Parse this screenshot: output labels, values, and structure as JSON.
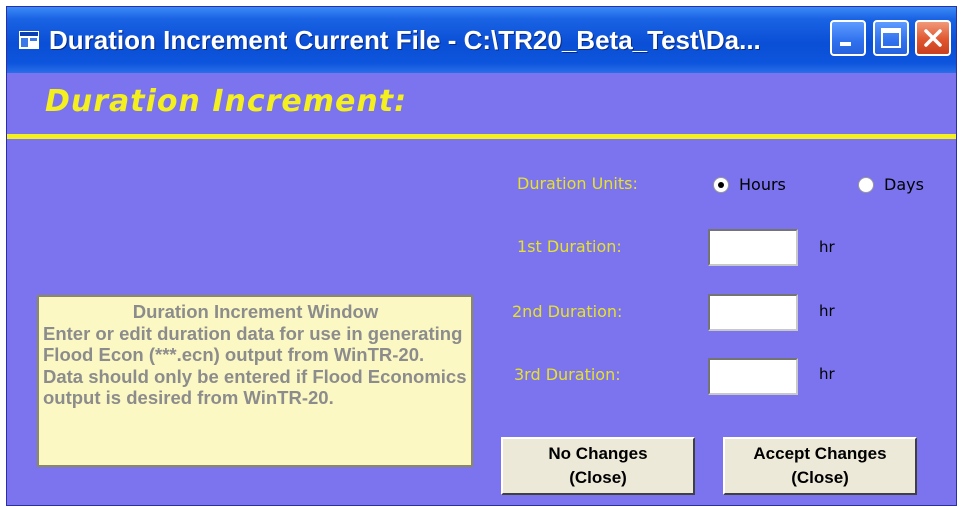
{
  "window": {
    "title": "Duration Increment   Current File - C:\\TR20_Beta_Test\\Da...",
    "controls": {
      "minimize": "minimize-icon",
      "maximize": "maximize-icon",
      "close": "close-icon"
    },
    "icon": "window-app-icon"
  },
  "heading": "Duration Increment:",
  "help": {
    "title": "Duration Increment Window",
    "body": "Enter or edit duration data for use in generating Flood Econ (***.ecn) output from WinTR-20.  Data should only be entered if Flood Economics output is desired from WinTR-20."
  },
  "units": {
    "label": "Duration Units:",
    "options": [
      {
        "label": "Hours",
        "checked": true
      },
      {
        "label": "Days",
        "checked": false
      }
    ]
  },
  "durations": [
    {
      "label": "1st Duration:",
      "value": "",
      "unit": "hr"
    },
    {
      "label": "2nd Duration:",
      "value": "",
      "unit": "hr"
    },
    {
      "label": "3rd Duration:",
      "value": "",
      "unit": "hr"
    }
  ],
  "buttons": {
    "no_changes": {
      "line1": "No Changes",
      "line2": "(Close)"
    },
    "accept_changes": {
      "line1": "Accept Changes",
      "line2": "(Close)"
    }
  },
  "colors": {
    "background": "#7b74ee",
    "accent_text": "#f4ef1e",
    "help_background": "#fbf8c4",
    "titlebar": "#0a4fd6"
  }
}
